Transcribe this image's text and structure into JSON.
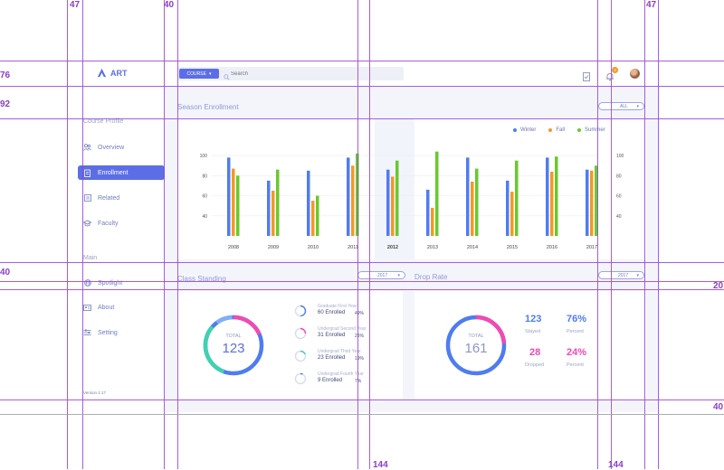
{
  "app": {
    "logo": "ART",
    "version": "Version 2.17"
  },
  "header": {
    "course_btn": "COURSE",
    "search_placeholder": "Search",
    "notif_count": "3"
  },
  "sidebar": {
    "section1": "Course Profile",
    "items1": [
      {
        "label": "Overview"
      },
      {
        "label": "Enrollment"
      },
      {
        "label": "Related"
      },
      {
        "label": "Faculty"
      }
    ],
    "section2": "Main",
    "items2": [
      {
        "label": "Spotlight"
      },
      {
        "label": "About"
      },
      {
        "label": "Setting"
      }
    ]
  },
  "season": {
    "title": "Season Enrollment",
    "filter": "ALL"
  },
  "chart_data": {
    "type": "bar",
    "categories": [
      "2008",
      "2009",
      "2010",
      "2011",
      "2012",
      "2013",
      "2014",
      "2015",
      "2016",
      "2017"
    ],
    "highlight": "2012",
    "series": [
      {
        "name": "Winter",
        "color": "#4f7cf0",
        "values": [
          98,
          75,
          85,
          98,
          86,
          66,
          98,
          75,
          98,
          86
        ]
      },
      {
        "name": "Fall",
        "color": "#f29a22",
        "values": [
          87,
          65,
          55,
          90,
          79,
          48,
          74,
          64,
          84,
          85
        ]
      },
      {
        "name": "Summer",
        "color": "#69c92e",
        "values": [
          80,
          86,
          60,
          102,
          95,
          104,
          87,
          95,
          99,
          90
        ]
      }
    ],
    "yticks": [
      40,
      60,
      80,
      100
    ],
    "ylim": [
      20,
      110
    ],
    "legend": "top-right"
  },
  "class_standing": {
    "title": "Class Standing",
    "filter": "2017",
    "total_label": "TOTAL",
    "total": "123",
    "rows": [
      {
        "title": "Graduate First Year",
        "enrolled": "60 Enrolled",
        "pct": "49%",
        "color": "#4f7cf0",
        "frac": 0.49
      },
      {
        "title": "Undergrad Second Year",
        "enrolled": "31 Enrolled",
        "pct": "25%",
        "color": "#f04ab3",
        "frac": 0.25
      },
      {
        "title": "Undergrad Third Year",
        "enrolled": "23 Enrolled",
        "pct": "19%",
        "color": "#3fd2b0",
        "frac": 0.19
      },
      {
        "title": "Undergrad Fourth Year",
        "enrolled": "9 Enrolled",
        "pct": "7%",
        "color": "#4f7cf0",
        "frac": 0.07
      }
    ]
  },
  "drop_rate": {
    "title": "Drop Rate",
    "filter": "2017",
    "total_label": "TOTAL",
    "total": "161",
    "stayed_num": "123",
    "stayed_label": "Stayed",
    "stayed_pct": "76%",
    "dropped_num": "28",
    "dropped_label": "Dropped",
    "dropped_pct": "24%",
    "percent_label": "Percent"
  },
  "guides": {
    "left1": "47",
    "left2": "40",
    "right1": "47",
    "left_a": "76",
    "left_b": "92",
    "left_c": "40",
    "right_c": "20",
    "right_d": "40",
    "bot1": "144",
    "bot2": "144"
  }
}
